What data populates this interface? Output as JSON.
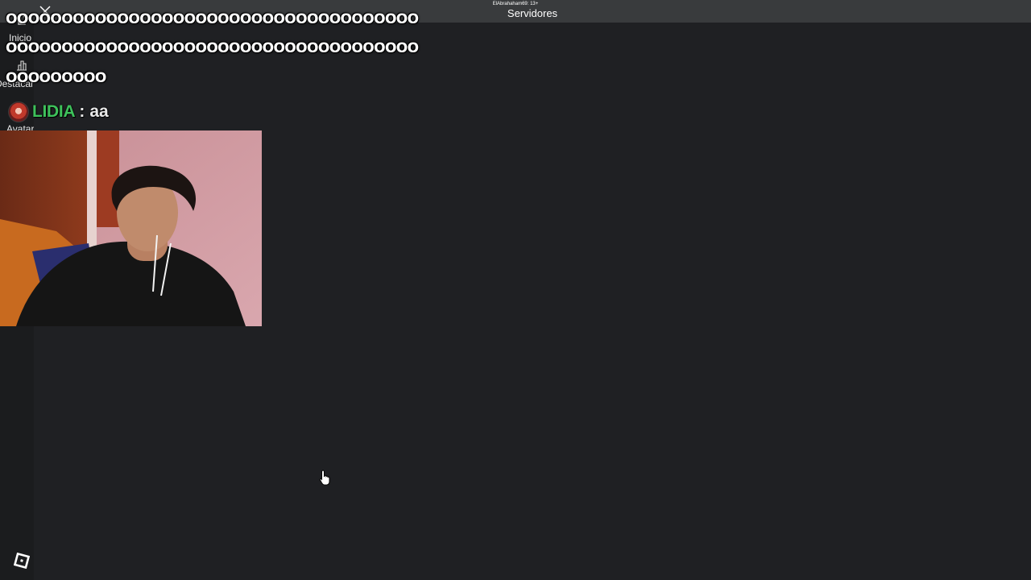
{
  "topbar": {
    "user_text": "ElAbrahaham69: 13+",
    "title": "Servidores"
  },
  "sidebar": {
    "items": [
      {
        "label": "Inicio",
        "icon": "home-icon"
      },
      {
        "label": "Destacar",
        "icon": "charts-icon"
      },
      {
        "label": "Avatar",
        "icon": "avatar-icon"
      }
    ],
    "logo_icon": "roblox-logo-icon"
  },
  "chat": {
    "lines": [
      "OOOOOOOOOOOOOOOOOOOOOOOOOOOOOOOOOOOOO",
      "OOOOOOOOOOOOOOOOOOOOOOOOOOOOOOOOOOOOO",
      "OOOOOOOOO"
    ],
    "user_message": {
      "name": "LIDIA",
      "separator": ":",
      "text": "aa"
    }
  },
  "colors": {
    "background": "#1f2023",
    "topbar": "#393b3d",
    "sidebar": "#1b1c1e",
    "chat_name": "#3ec15b"
  }
}
